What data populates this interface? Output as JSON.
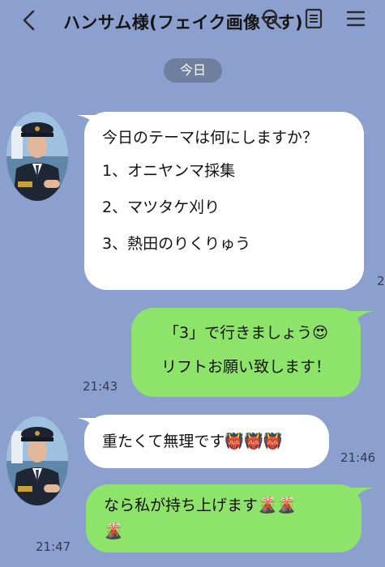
{
  "header": {
    "title": "ハンサム様(フェイク画像です)",
    "icons": [
      "back-icon",
      "search-icon",
      "notes-icon",
      "menu-icon"
    ]
  },
  "date_separator": "今日",
  "messages": [
    {
      "sender": "other",
      "lines": [
        "今日のテーマは何にしますか？",
        "1、オニヤンマ採集",
        "2、マツタケ刈り",
        "3、熱田のりくりゅう"
      ],
      "time": "2"
    },
    {
      "sender": "me",
      "lines": [
        "「3」で行きましょう😍",
        "リフトお願い致します！"
      ],
      "time": "21:43"
    },
    {
      "sender": "other",
      "lines": [
        "重たくて無理です👹👹👹"
      ],
      "time": "21:46"
    },
    {
      "sender": "me",
      "lines": [
        "なら私が持ち上げます🌋🌋",
        "🌋"
      ],
      "time": "21:47"
    }
  ],
  "colors": {
    "background": "#8ca0cf",
    "my_bubble": "#8ee46a",
    "their_bubble": "#ffffff",
    "date_pill": "#6f7f9e"
  }
}
